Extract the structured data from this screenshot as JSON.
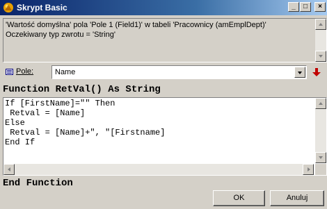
{
  "window": {
    "title": "Skrypt Basic",
    "controls": {
      "minimize": "_",
      "maximize": "□",
      "close": "×"
    }
  },
  "description": {
    "line1": "'Wartość domyślna' pola 'Pole 1 (Field1)' w tabeli 'Pracownicy (amEmplDept)'",
    "line2": "Oczekiwany typ zwrotu = 'String'"
  },
  "field": {
    "label_underlined": "P",
    "label_rest": "ole:",
    "value": "Name",
    "icon": "field-icon"
  },
  "function": {
    "header": "Function RetVal() As String",
    "footer": "End Function",
    "code_lines": [
      "If [FirstName]=\"\" Then",
      " Retval = [Name]",
      "Else",
      " Retval = [Name]+\", \"[Firstname]",
      "End If"
    ]
  },
  "buttons": {
    "ok": "OK",
    "cancel": "Anuluj"
  },
  "colors": {
    "titlebar_start": "#0a246a",
    "titlebar_end": "#a6caf0",
    "face": "#d4d0c8",
    "insert_arrow": "#c00000"
  }
}
